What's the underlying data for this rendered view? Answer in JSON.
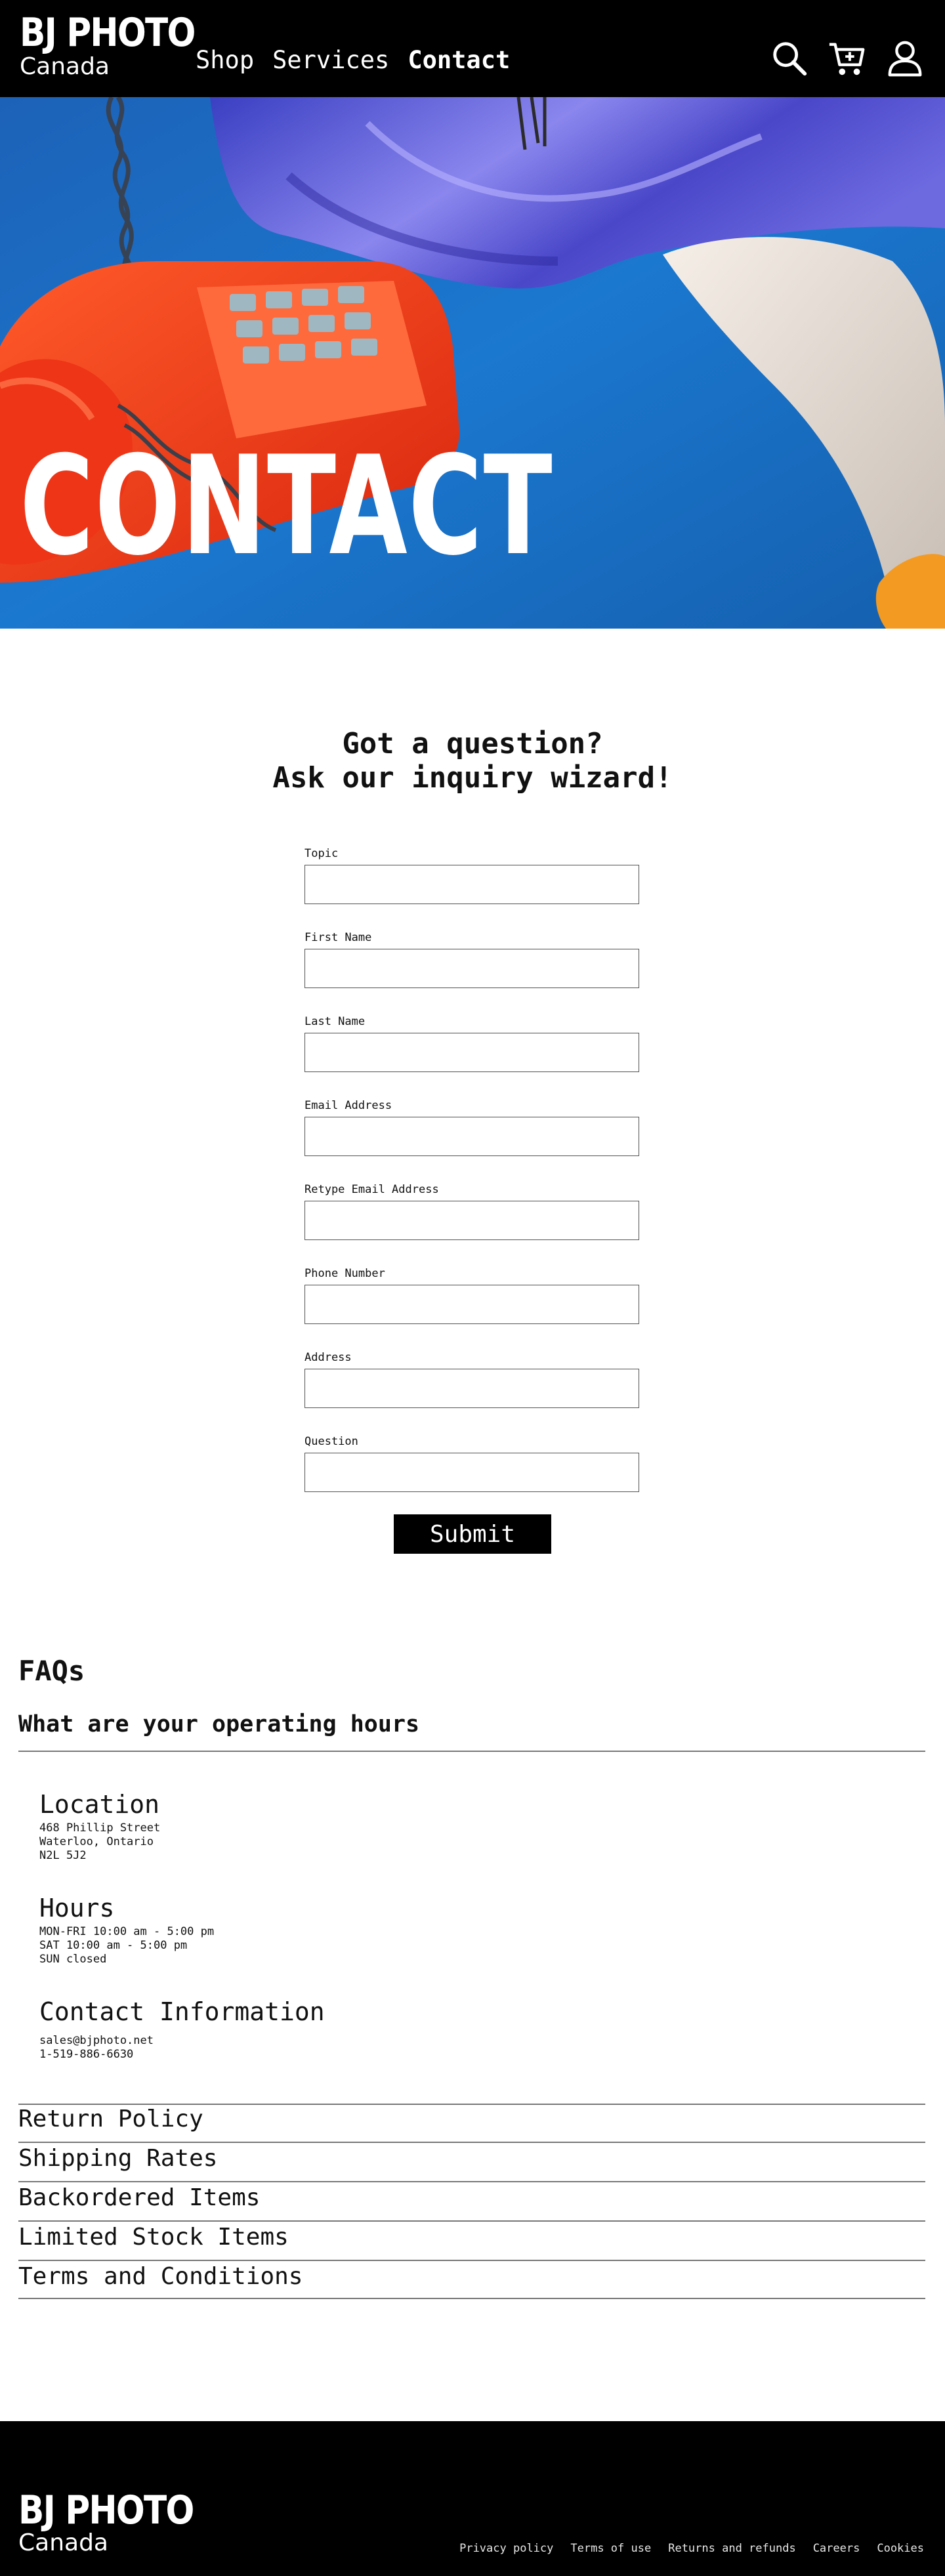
{
  "brand": {
    "name": "BJ PHOTO",
    "region": "Canada"
  },
  "nav": {
    "items": [
      {
        "label": "Shop",
        "active": false
      },
      {
        "label": "Services",
        "active": false
      },
      {
        "label": "Contact",
        "active": true
      }
    ]
  },
  "header_icons": [
    "search-icon",
    "cart-icon",
    "account-icon"
  ],
  "hero": {
    "title": "CONTACT"
  },
  "form": {
    "heading_line1": "Got a question?",
    "heading_line2": "Ask our inquiry wizard!",
    "fields": [
      {
        "label": "Topic",
        "value": ""
      },
      {
        "label": "First Name",
        "value": ""
      },
      {
        "label": "Last Name",
        "value": ""
      },
      {
        "label": "Email Address",
        "value": ""
      },
      {
        "label": "Retype Email Address",
        "value": ""
      },
      {
        "label": "Phone Number",
        "value": ""
      },
      {
        "label": "Address",
        "value": ""
      },
      {
        "label": "Question",
        "value": ""
      }
    ],
    "submit_label": "Submit"
  },
  "faq": {
    "title": "FAQs",
    "open_question": "What are your operating hours",
    "location": {
      "heading": "Location",
      "lines": [
        "468 Phillip Street",
        "Waterloo, Ontario",
        "N2L 5J2"
      ]
    },
    "hours": {
      "heading": "Hours",
      "lines": [
        "MON-FRI 10:00 am - 5:00 pm",
        "SAT 10:00 am - 5:00 pm",
        "SUN closed"
      ]
    },
    "contact": {
      "heading": "Contact Information",
      "lines": [
        "sales@bjphoto.net",
        "1-519-886-6630"
      ]
    },
    "items": [
      "Return Policy",
      "Shipping Rates",
      "Backordered Items",
      "Limited Stock Items",
      "Terms and Conditions"
    ]
  },
  "footer": {
    "links": [
      "Privacy policy",
      "Terms of use",
      "Returns and refunds",
      "Careers",
      "Cookies"
    ]
  },
  "colors": {
    "header_bg": "#000000",
    "footer_bg": "#000000",
    "hero_blue": "#1a6fc4",
    "phone_red": "#f03a1c",
    "button_bg": "#000000"
  }
}
